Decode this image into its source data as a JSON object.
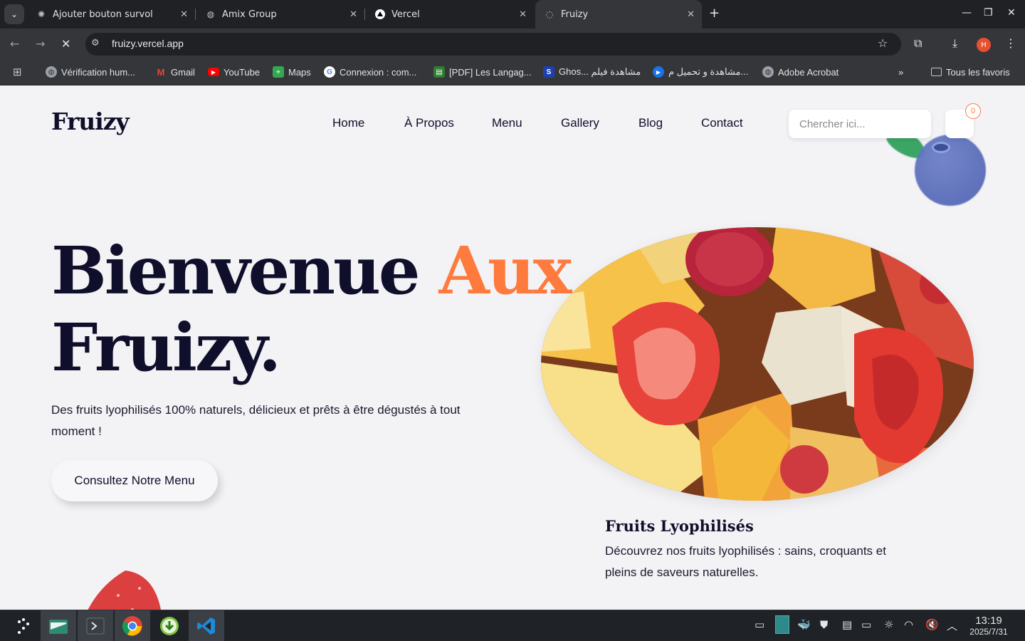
{
  "browser": {
    "tabs": [
      {
        "title": "Ajouter bouton survol",
        "icon": "openai-icon",
        "active": false
      },
      {
        "title": "Amix Group",
        "icon": "globe-icon",
        "active": false
      },
      {
        "title": "Vercel",
        "icon": "vercel-icon",
        "active": false
      },
      {
        "title": "Fruizy",
        "icon": "loading-icon",
        "active": true
      }
    ],
    "url": "fruizy.vercel.app",
    "profile_initial": "H",
    "bookmarks": [
      {
        "label": "Vérification hum...",
        "icon": "globe-icon"
      },
      {
        "label": "Gmail",
        "icon": "gmail-icon"
      },
      {
        "label": "YouTube",
        "icon": "youtube-icon"
      },
      {
        "label": "Maps",
        "icon": "maps-icon"
      },
      {
        "label": "Connexion : com...",
        "icon": "google-icon"
      },
      {
        "label": "[PDF] Les Langag...",
        "icon": "pdf-icon"
      },
      {
        "label": "Ghos... مشاهدة فيلم",
        "icon": "site-icon"
      },
      {
        "label": "مشاهدة و تحميل م...",
        "icon": "play-icon"
      },
      {
        "label": "Adobe Acrobat",
        "icon": "globe-icon"
      }
    ],
    "all_bookmarks": "Tous les favoris"
  },
  "site": {
    "logo": "Fruizy",
    "nav": [
      "Home",
      "À Propos",
      "Menu",
      "Gallery",
      "Blog",
      "Contact"
    ],
    "search_placeholder": "Chercher ici...",
    "cart_count": "0",
    "hero": {
      "title_part1": "Bienvenue ",
      "title_accent": "Aux",
      "title_part2": "Fruizy.",
      "subtitle": "Des fruits lyophilisés 100% naturels, délicieux et prêts à être dégustés à tout moment !",
      "cta": "Consultez Notre Menu"
    },
    "card": {
      "title": "Fruits Lyophilisés",
      "description": "Découvrez nos fruits lyophilisés : sains, croquants et pleins de saveurs naturelles."
    },
    "colors": {
      "accent": "#ff7a3d",
      "dark": "#0f0f2b",
      "background": "#f3f2f5"
    }
  },
  "taskbar": {
    "apps": [
      "launcher-icon",
      "files-icon",
      "terminal-icon",
      "chrome-icon",
      "download-manager-icon",
      "vscode-icon"
    ],
    "time": "13:19",
    "date": "2025/7/31"
  }
}
